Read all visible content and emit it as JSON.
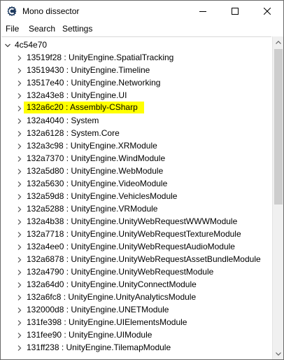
{
  "window": {
    "title": "Mono dissector",
    "controls": {
      "minimize": "minimize",
      "maximize": "maximize",
      "close": "close"
    }
  },
  "menu": [
    "File",
    "Search",
    "Settings"
  ],
  "tree": {
    "root": {
      "label": "4c54e70",
      "expanded": true
    },
    "selected_index": 4,
    "highlight_color": "#ffff00",
    "items": [
      "13519f28 : UnityEngine.SpatialTracking",
      "13519430 : UnityEngine.Timeline",
      "13517e40 : UnityEngine.Networking",
      "132a43e8 : UnityEngine.UI",
      "132a6c20 : Assembly-CSharp",
      "132a4040 : System",
      "132a6128 : System.Core",
      "132a3c98 : UnityEngine.XRModule",
      "132a7370 : UnityEngine.WindModule",
      "132a5d80 : UnityEngine.WebModule",
      "132a5630 : UnityEngine.VideoModule",
      "132a59d8 : UnityEngine.VehiclesModule",
      "132a5288 : UnityEngine.VRModule",
      "132a4b38 : UnityEngine.UnityWebRequestWWWModule",
      "132a7718 : UnityEngine.UnityWebRequestTextureModule",
      "132a4ee0 : UnityEngine.UnityWebRequestAudioModule",
      "132a6878 : UnityEngine.UnityWebRequestAssetBundleModule",
      "132a4790 : UnityEngine.UnityWebRequestModule",
      "132a64d0 : UnityEngine.UnityConnectModule",
      "132a6fc8 : UnityEngine.UnityAnalyticsModule",
      "132000d8 : UnityEngine.UNETModule",
      "131fe398 : UnityEngine.UIElementsModule",
      "131fee90 : UnityEngine.UIModule",
      "131ff238 : UnityEngine.TilemapModule"
    ]
  },
  "scrollbar": {
    "position_fraction": 0.0,
    "visible_fraction": 0.52
  }
}
